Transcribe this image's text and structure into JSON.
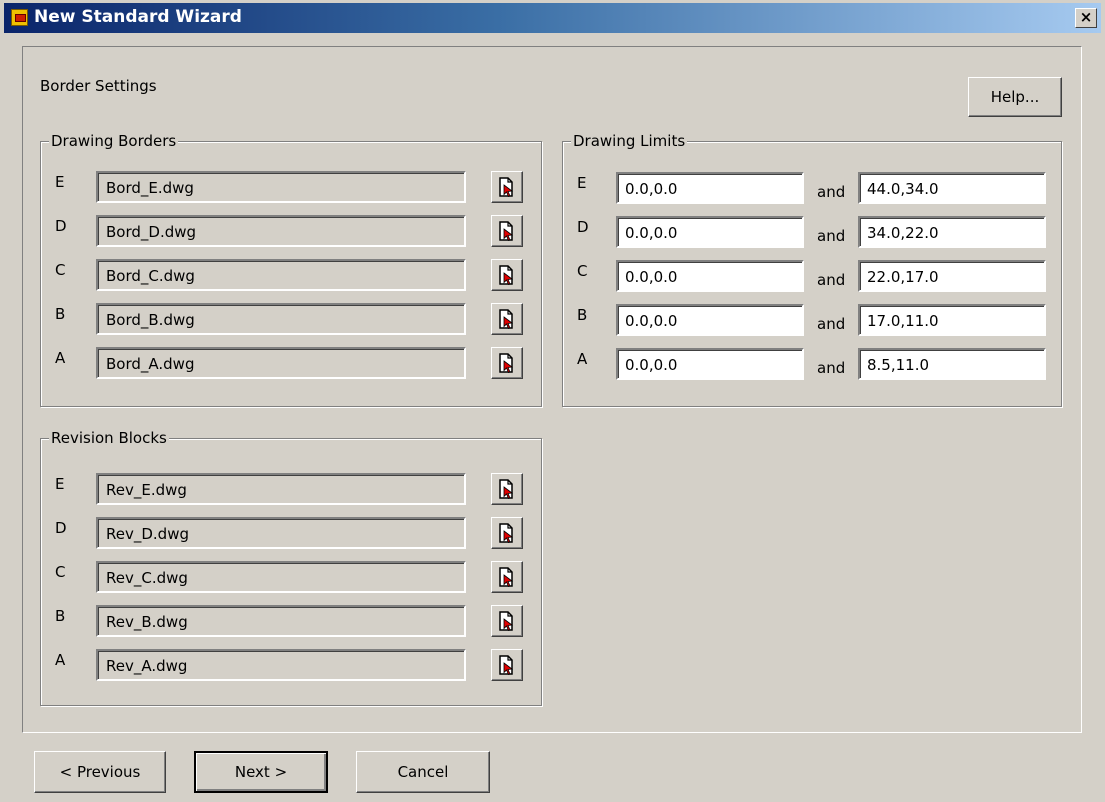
{
  "window": {
    "title": "New Standard Wizard",
    "close_label": "×"
  },
  "page": {
    "heading": "Border Settings",
    "help_label": "Help..."
  },
  "drawing_borders": {
    "title": "Drawing Borders",
    "rows": [
      {
        "letter": "E",
        "file": "Bord_E.dwg"
      },
      {
        "letter": "D",
        "file": "Bord_D.dwg"
      },
      {
        "letter": "C",
        "file": "Bord_C.dwg"
      },
      {
        "letter": "B",
        "file": "Bord_B.dwg"
      },
      {
        "letter": "A",
        "file": "Bord_A.dwg"
      }
    ]
  },
  "drawing_limits": {
    "title": "Drawing Limits",
    "and_label": "and",
    "rows": [
      {
        "letter": "E",
        "from": "0.0,0.0",
        "to": "44.0,34.0"
      },
      {
        "letter": "D",
        "from": "0.0,0.0",
        "to": "34.0,22.0"
      },
      {
        "letter": "C",
        "from": "0.0,0.0",
        "to": "22.0,17.0"
      },
      {
        "letter": "B",
        "from": "0.0,0.0",
        "to": "17.0,11.0"
      },
      {
        "letter": "A",
        "from": "0.0,0.0",
        "to": "8.5,11.0"
      }
    ]
  },
  "revision_blocks": {
    "title": "Revision Blocks",
    "rows": [
      {
        "letter": "E",
        "file": "Rev_E.dwg"
      },
      {
        "letter": "D",
        "file": "Rev_D.dwg"
      },
      {
        "letter": "C",
        "file": "Rev_C.dwg"
      },
      {
        "letter": "B",
        "file": "Rev_B.dwg"
      },
      {
        "letter": "A",
        "file": "Rev_A.dwg"
      }
    ]
  },
  "footer": {
    "previous_label": "< Previous",
    "next_label": "Next >",
    "cancel_label": "Cancel"
  },
  "icons": {
    "app": "wizard-app-icon",
    "browse": "browse-file-icon",
    "close": "close-icon"
  }
}
